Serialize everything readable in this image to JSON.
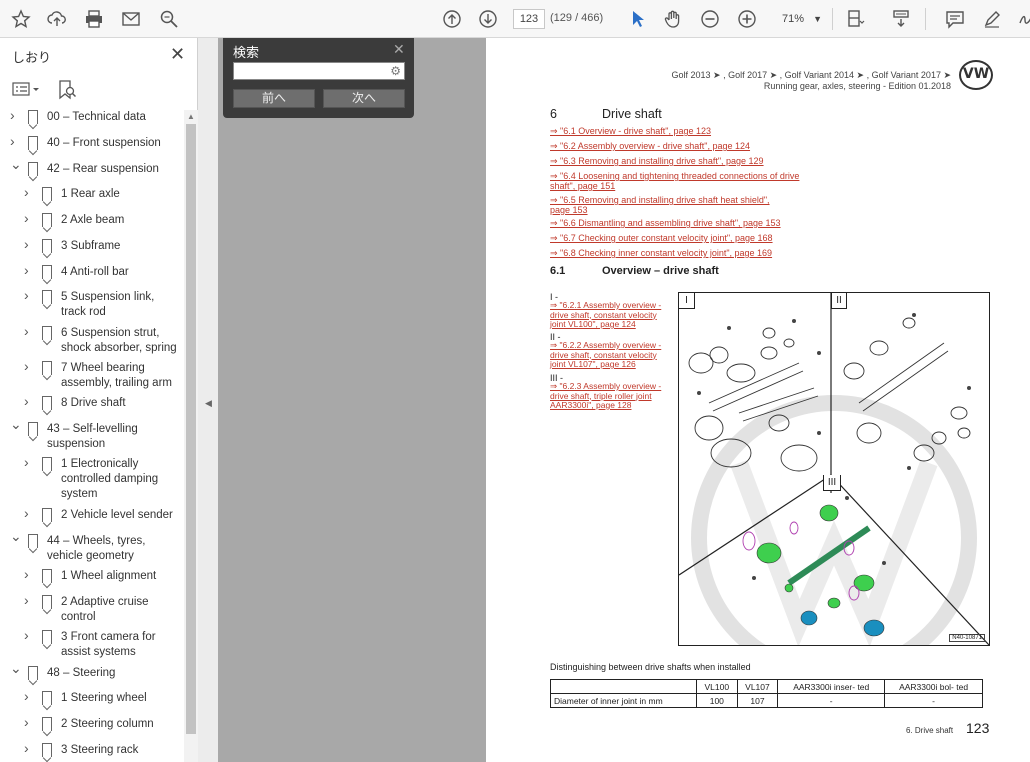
{
  "toolbar": {
    "page_current": "123",
    "page_count": "(129 / 466)",
    "zoom": "71%"
  },
  "sidebar": {
    "title": "しおり",
    "bookmarks": [
      {
        "label": "00 – Technical data",
        "level": 0,
        "expanded": false
      },
      {
        "label": "40 – Front suspension",
        "level": 0,
        "expanded": false
      },
      {
        "label": "42 – Rear suspension",
        "level": 0,
        "expanded": true
      },
      {
        "label": "1 Rear axle",
        "level": 1,
        "expanded": false
      },
      {
        "label": "2 Axle beam",
        "level": 1,
        "expanded": false
      },
      {
        "label": "3 Subframe",
        "level": 1,
        "expanded": false
      },
      {
        "label": "4 Anti-roll bar",
        "level": 1,
        "expanded": false
      },
      {
        "label": "5 Suspension link, track rod",
        "level": 1,
        "expanded": false
      },
      {
        "label": "6 Suspension strut, shock absorber, spring",
        "level": 1,
        "expanded": false
      },
      {
        "label": "7 Wheel bearing assembly, trailing arm",
        "level": 1,
        "expanded": false
      },
      {
        "label": "8 Drive shaft",
        "level": 1,
        "expanded": false
      },
      {
        "label": "43 – Self-levelling suspension",
        "level": 0,
        "expanded": true
      },
      {
        "label": "1 Electronically controlled damping system",
        "level": 1,
        "expanded": false
      },
      {
        "label": "2 Vehicle level sender",
        "level": 1,
        "expanded": false
      },
      {
        "label": "44 – Wheels, tyres, vehicle geometry",
        "level": 0,
        "expanded": true
      },
      {
        "label": "1 Wheel alignment",
        "level": 1,
        "expanded": false
      },
      {
        "label": "2 Adaptive cruise control",
        "level": 1,
        "expanded": false
      },
      {
        "label": "3 Front camera for assist systems",
        "level": 1,
        "expanded": false
      },
      {
        "label": "48 – Steering",
        "level": 0,
        "expanded": true
      },
      {
        "label": "1 Steering wheel",
        "level": 1,
        "expanded": false
      },
      {
        "label": "2 Steering column",
        "level": 1,
        "expanded": false
      },
      {
        "label": "3 Steering rack",
        "level": 1,
        "expanded": false
      }
    ]
  },
  "search": {
    "title": "検索",
    "prev_label": "前へ",
    "next_label": "次へ"
  },
  "document": {
    "header_line1": "Golf 2013 ➤ , Golf 2017 ➤ , Golf Variant 2014 ➤ , Golf Variant 2017 ➤",
    "header_line2": "Running gear, axles, steering - Edition 01.2018",
    "logo_text": "VW",
    "section_number": "6",
    "section_title": "Drive shaft",
    "toc_links": [
      "⇒ \"6.1 Overview - drive shaft\", page 123",
      "⇒ \"6.2 Assembly overview - drive shaft\", page 124",
      "⇒ \"6.3 Removing and installing drive shaft\", page 129",
      "⇒ \"6.4 Loosening and tightening threaded connections of drive shaft\", page 151",
      "⇒ \"6.5 Removing and installing drive shaft heat shield\", page 153",
      "⇒ \"6.6 Dismantling and assembling drive shaft\", page 153",
      "⇒ \"6.7 Checking outer constant velocity joint\", page 168",
      "⇒ \"6.8 Checking inner constant velocity joint\", page 169"
    ],
    "subsection_number": "6.1",
    "subsection_title": "Overview – drive shaft",
    "side_refs": [
      {
        "label": "I -",
        "link": "⇒ \"6.2.1 Assembly overview - drive shaft, constant velocity joint VL100\", page 124"
      },
      {
        "label": "II -",
        "link": "⇒ \"6.2.2 Assembly overview - drive shaft, constant velocity joint VL107\", page 126"
      },
      {
        "label": "III -",
        "link": "⇒ \"6.2.3 Assembly overview - drive shaft, triple roller joint AAR3300i\", page 128"
      }
    ],
    "figure_labels": [
      "I",
      "II",
      "III"
    ],
    "figure_code": "N40-10871",
    "table_caption": "Distinguishing between drive shafts when installed",
    "table_headers": [
      "",
      "VL100",
      "VL107",
      "AAR3300i inser- ted",
      "AAR3300i bol- ted"
    ],
    "table_row": [
      "Diameter of inner joint in mm",
      "100",
      "107",
      "-",
      "-"
    ],
    "footer_text": "6. Drive shaft",
    "footer_page": "123"
  }
}
